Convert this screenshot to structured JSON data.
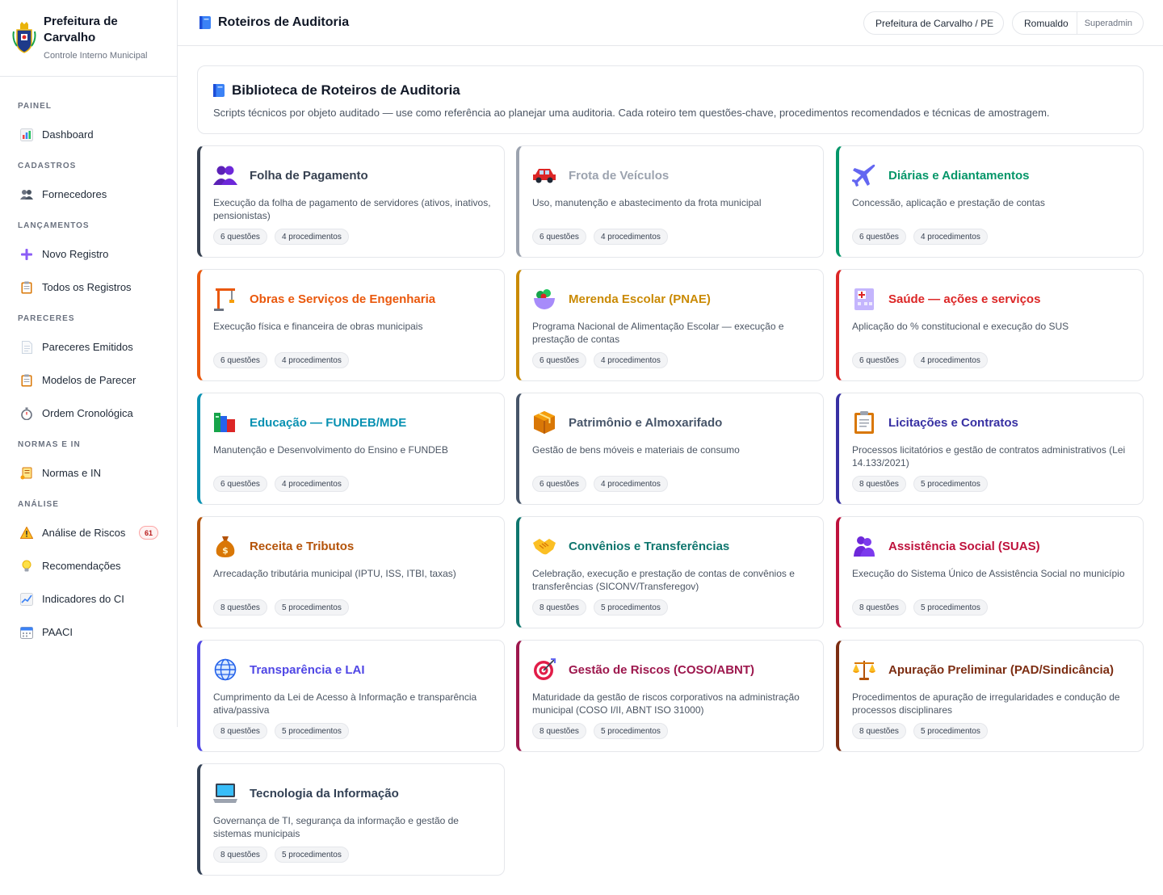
{
  "brand": {
    "title": "Prefeitura de Carvalho",
    "subtitle": "Controle Interno Municipal",
    "logo_icon": "coat-of-arms-icon"
  },
  "sidebar": {
    "sections": [
      {
        "title": "PAINEL",
        "items": [
          {
            "label": "Dashboard",
            "icon": "bar-chart-icon"
          }
        ]
      },
      {
        "title": "CADASTROS",
        "items": [
          {
            "label": "Fornecedores",
            "icon": "people-icon"
          }
        ]
      },
      {
        "title": "LANÇAMENTOS",
        "items": [
          {
            "label": "Novo Registro",
            "icon": "plus-icon"
          },
          {
            "label": "Todos os Registros",
            "icon": "clipboard-icon"
          }
        ]
      },
      {
        "title": "PARECERES",
        "items": [
          {
            "label": "Pareceres Emitidos",
            "icon": "document-icon"
          },
          {
            "label": "Modelos de Parecer",
            "icon": "clipboard-icon"
          },
          {
            "label": "Ordem Cronológica",
            "icon": "stopwatch-icon"
          }
        ]
      },
      {
        "title": "NORMAS E IN",
        "items": [
          {
            "label": "Normas e IN",
            "icon": "scroll-icon"
          }
        ]
      },
      {
        "title": "ANÁLISE",
        "items": [
          {
            "label": "Análise de Riscos",
            "icon": "warning-icon",
            "badge": "61"
          },
          {
            "label": "Recomendações",
            "icon": "lightbulb-icon"
          },
          {
            "label": "Indicadores do CI",
            "icon": "line-chart-icon"
          },
          {
            "label": "PAACI",
            "icon": "calendar-icon"
          }
        ]
      }
    ]
  },
  "header": {
    "title": "Roteiros de Auditoria",
    "title_icon": "book-icon",
    "org": "Prefeitura de Carvalho / PE",
    "user": "Romualdo",
    "role": "Superadmin"
  },
  "intro": {
    "title": "Biblioteca de Roteiros de Auditoria",
    "title_icon": "book-icon",
    "description": "Scripts técnicos por objeto auditado — use como referência ao planejar uma auditoria. Cada roteiro tem questões-chave, procedimentos recomendados e técnicas de amostragem."
  },
  "cards": [
    {
      "title": "Folha de Pagamento",
      "description": "Execução da folha de pagamento de servidores (ativos, inativos, pensionistas)",
      "questions": "6 questões",
      "procedures": "4 procedimentos",
      "color": "#374151",
      "icon": "people-icon"
    },
    {
      "title": "Frota de Veículos",
      "description": "Uso, manutenção e abastecimento da frota municipal",
      "questions": "6 questões",
      "procedures": "4 procedimentos",
      "color": "#9ca3af",
      "icon": "car-icon"
    },
    {
      "title": "Diárias e Adiantamentos",
      "description": "Concessão, aplicação e prestação de contas",
      "questions": "6 questões",
      "procedures": "4 procedimentos",
      "color": "#059669",
      "icon": "airplane-icon"
    },
    {
      "title": "Obras e Serviços de Engenharia",
      "description": "Execução física e financeira de obras municipais",
      "questions": "6 questões",
      "procedures": "4 procedimentos",
      "color": "#ea580c",
      "icon": "crane-icon"
    },
    {
      "title": "Merenda Escolar (PNAE)",
      "description": "Programa Nacional de Alimentação Escolar — execução e prestação de contas",
      "questions": "6 questões",
      "procedures": "4 procedimentos",
      "color": "#ca8a04",
      "icon": "salad-icon"
    },
    {
      "title": "Saúde — ações e serviços",
      "description": "Aplicação do % constitucional e execução do SUS",
      "questions": "6 questões",
      "procedures": "4 procedimentos",
      "color": "#dc2626",
      "icon": "hospital-icon"
    },
    {
      "title": "Educação — FUNDEB/MDE",
      "description": "Manutenção e Desenvolvimento do Ensino e FUNDEB",
      "questions": "6 questões",
      "procedures": "4 procedimentos",
      "color": "#0891b2",
      "icon": "books-icon"
    },
    {
      "title": "Patrimônio e Almoxarifado",
      "description": "Gestão de bens móveis e materiais de consumo",
      "questions": "6 questões",
      "procedures": "4 procedimentos",
      "color": "#475569",
      "icon": "package-icon"
    },
    {
      "title": "Licitações e Contratos",
      "description": "Processos licitatórios e gestão de contratos administrativos (Lei 14.133/2021)",
      "questions": "8 questões",
      "procedures": "5 procedimentos",
      "color": "#3730a3",
      "icon": "clipboard-icon"
    },
    {
      "title": "Receita e Tributos",
      "description": "Arrecadação tributária municipal (IPTU, ISS, ITBI, taxas)",
      "questions": "8 questões",
      "procedures": "5 procedimentos",
      "color": "#b45309",
      "icon": "money-bag-icon"
    },
    {
      "title": "Convênios e Transferências",
      "description": "Celebração, execução e prestação de contas de convênios e transferências (SICONV/Transferegov)",
      "questions": "8 questões",
      "procedures": "5 procedimentos",
      "color": "#0f766e",
      "icon": "handshake-icon"
    },
    {
      "title": "Assistência Social (SUAS)",
      "description": "Execução do Sistema Único de Assistência Social no município",
      "questions": "8 questões",
      "procedures": "5 procedimentos",
      "color": "#be123c",
      "icon": "people-hug-icon"
    },
    {
      "title": "Transparência e LAI",
      "description": "Cumprimento da Lei de Acesso à Informação e transparência ativa/passiva",
      "questions": "8 questões",
      "procedures": "5 procedimentos",
      "color": "#4f46e5",
      "icon": "globe-icon"
    },
    {
      "title": "Gestão de Riscos (COSO/ABNT)",
      "description": "Maturidade da gestão de riscos corporativos na administração municipal (COSO I/II, ABNT ISO 31000)",
      "questions": "8 questões",
      "procedures": "5 procedimentos",
      "color": "#9d174d",
      "icon": "target-icon"
    },
    {
      "title": "Apuração Preliminar (PAD/Sindicância)",
      "description": "Procedimentos de apuração de irregularidades e condução de processos disciplinares",
      "questions": "8 questões",
      "procedures": "5 procedimentos",
      "color": "#7c2d12",
      "icon": "scales-icon"
    },
    {
      "title": "Tecnologia da Informação",
      "description": "Governança de TI, segurança da informação e gestão de sistemas municipais",
      "questions": "8 questões",
      "procedures": "5 procedimentos",
      "color": "#334155",
      "icon": "laptop-icon"
    }
  ]
}
